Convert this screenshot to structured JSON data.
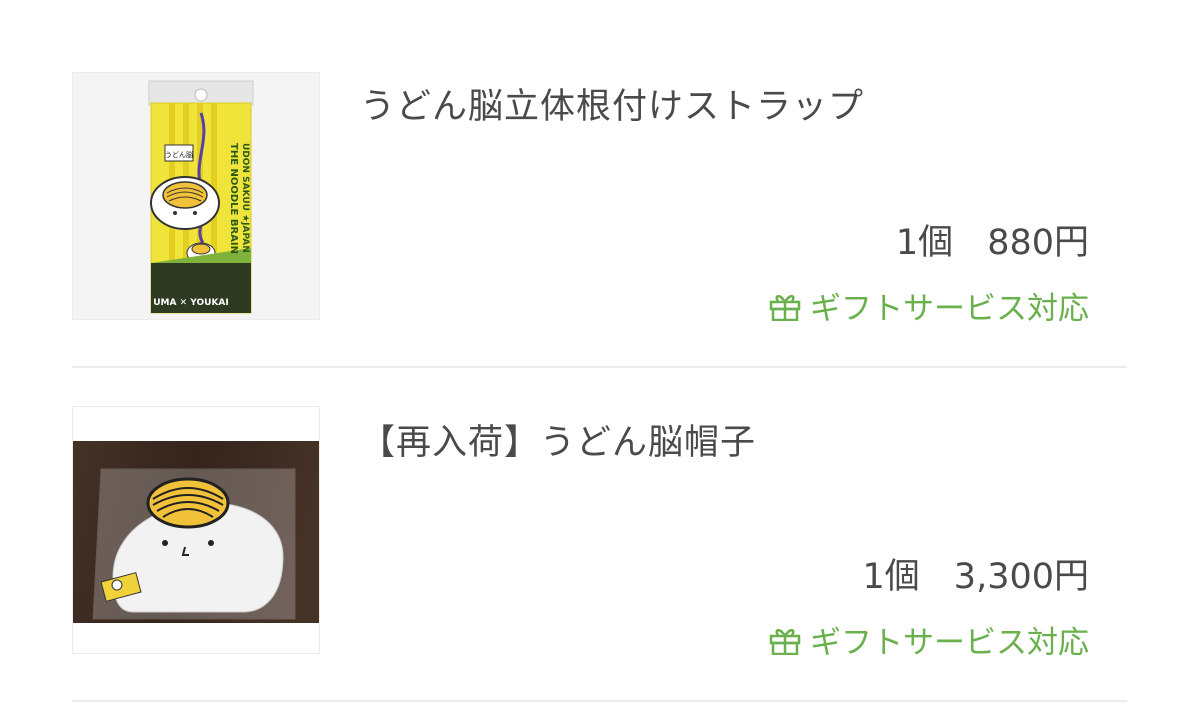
{
  "items": [
    {
      "title": "うどん脳立体根付けストラップ",
      "quantity": "1個",
      "price": "880円",
      "gift_label": "ギフトサービス対応",
      "image": {
        "package_text_top": "うどん脳",
        "package_text_side": "THE NOODLE BRAIN",
        "package_text_side2": "UDON SAKUU ★JAPAN",
        "package_text_bottom": "UMA ✕ YOUKAI"
      }
    },
    {
      "title": "【再入荷】うどん脳帽子",
      "quantity": "1個",
      "price": "3,300円",
      "gift_label": "ギフトサービス対応"
    }
  ],
  "colors": {
    "text": "#4a4a4a",
    "gift_green": "#6ab04c",
    "divider": "#ebebf0"
  },
  "icons": {
    "gift": "gift-box-icon"
  }
}
